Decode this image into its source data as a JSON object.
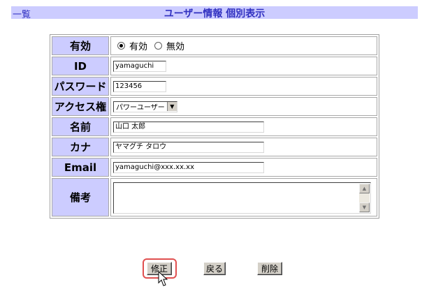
{
  "header": {
    "back_link": "一覧",
    "title": "ユーザー情報  個別表示"
  },
  "form": {
    "enabled": {
      "label": "有効",
      "options": [
        "有効",
        "無効"
      ],
      "selected": "有効"
    },
    "id": {
      "label": "ID",
      "value": "yamaguchi"
    },
    "password": {
      "label": "パスワード",
      "value": "123456"
    },
    "access": {
      "label": "アクセス権",
      "value": "パワーユーザー"
    },
    "name": {
      "label": "名前",
      "value": "山口  太郎"
    },
    "kana": {
      "label": "カナ",
      "value": "ヤマグチ  タロウ"
    },
    "email": {
      "label": "Email",
      "value": "yamaguchi@xxx.xx.xx"
    },
    "notes": {
      "label": "備考",
      "value": ""
    }
  },
  "actions": {
    "edit_label": "修正",
    "back_label": "戻る",
    "delete_label": "削除"
  },
  "colors": {
    "label_bg": "#ccccff",
    "title_text": "#3030c0",
    "focus_ring": "#e05050"
  }
}
